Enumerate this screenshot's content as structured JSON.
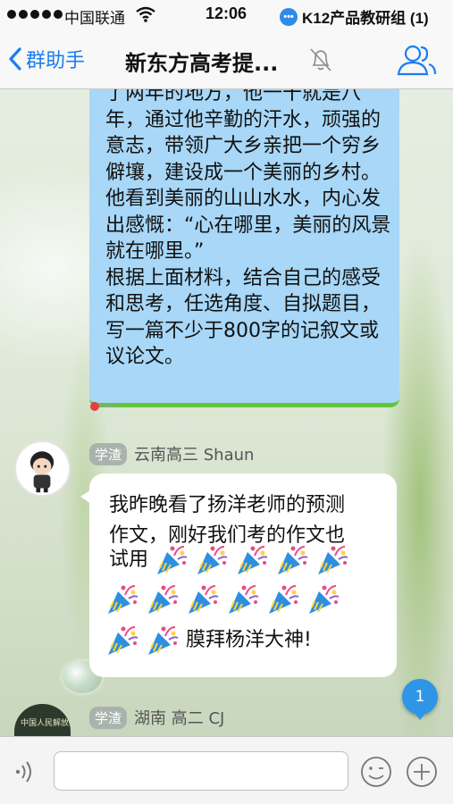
{
  "status_bar": {
    "carrier": "中国联通",
    "time": "12:06",
    "notification": "K12产品教研组 (1)"
  },
  "nav": {
    "back_label": "群助手",
    "title": "新东方高考提..."
  },
  "messages": {
    "previous_message_text": "了两年的地方，他一干就是八年，通过他辛勤的汗水，顽强的意志，带领广大乡亲把一个穷乡僻壤，建设成一个美丽的乡村。他看到美丽的山山水水，内心发出感慨：“心在哪里，美丽的风景就在哪里。”\n根据上面材料，结合自己的感受和思考，任选角度、自拟题目，写一篇不少于800字的记叙文或议论文。",
    "msg1": {
      "badge": "学渣",
      "sender": "云南高三 Shaun",
      "line1": "我昨晚看了扬洋老师的预测",
      "line2": "作文，刚好我们考的作文也",
      "line3": "试用",
      "line4": "膜拜杨洋大神!",
      "emoji_icon": "party-popper-icon"
    },
    "msg2": {
      "badge": "学渣",
      "sender": "湖南 高二 CJ",
      "avatar_text": "中国人民解放军 驻日本部队"
    },
    "unread_count": "1"
  },
  "colors": {
    "accent": "#1b7df2",
    "bubble_blue": "#a8d7f7",
    "bubble_green_edge": "#62c639"
  }
}
